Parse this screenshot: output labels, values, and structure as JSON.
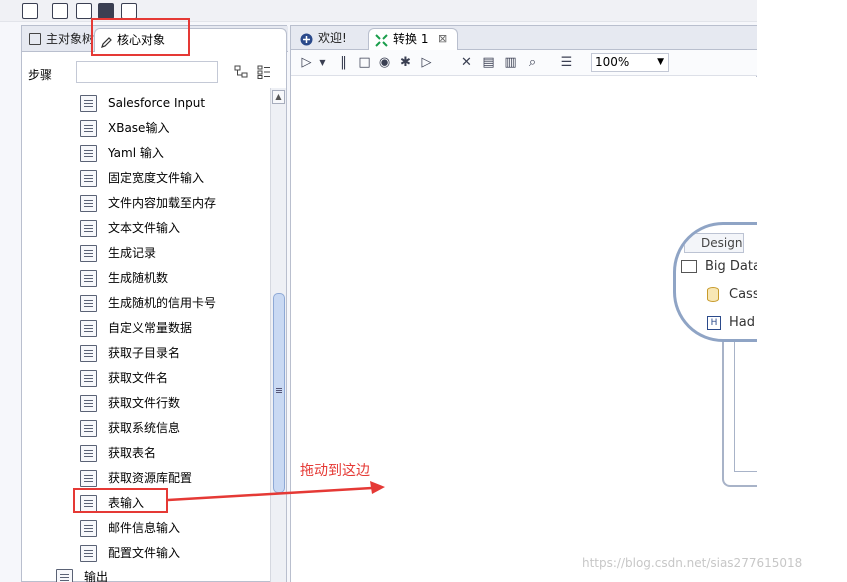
{
  "left_panel": {
    "tabs": [
      {
        "label": "主对象树",
        "icon": "tree-icon"
      },
      {
        "label": "核心对象",
        "icon": "pencil-icon"
      }
    ],
    "search": {
      "label": "步骤",
      "value": "",
      "placeholder": ""
    },
    "items": [
      {
        "label": "Salesforce Input",
        "icon": "salesforce-icon"
      },
      {
        "label": "XBase输入",
        "icon": "xbase-icon"
      },
      {
        "label": "Yaml 输入",
        "icon": "yaml-icon"
      },
      {
        "label": "固定宽度文件输入",
        "icon": "file-icon"
      },
      {
        "label": "文件内容加载至内存",
        "icon": "file-icon"
      },
      {
        "label": "文本文件输入",
        "icon": "file-icon"
      },
      {
        "label": "生成记录",
        "icon": "records-icon"
      },
      {
        "label": "生成随机数",
        "icon": "random-icon"
      },
      {
        "label": "生成随机的信用卡号",
        "icon": "credit-card-icon"
      },
      {
        "label": "自定义常量数据",
        "icon": "table-icon"
      },
      {
        "label": "获取子目录名",
        "icon": "folder-icon"
      },
      {
        "label": "获取文件名",
        "icon": "file-icon"
      },
      {
        "label": "获取文件行数",
        "icon": "file-icon"
      },
      {
        "label": "获取系统信息",
        "icon": "system-info-icon"
      },
      {
        "label": "获取表名",
        "icon": "table-icon"
      },
      {
        "label": "获取资源库配置",
        "icon": "repository-icon"
      },
      {
        "label": "表输入",
        "icon": "table-input-icon"
      },
      {
        "label": "邮件信息输入",
        "icon": "mail-icon"
      },
      {
        "label": "配置文件输入",
        "icon": "config-file-icon"
      },
      {
        "label": "输出",
        "icon": "folder-icon"
      }
    ]
  },
  "right_panel": {
    "tabs": [
      {
        "label": "欢迎!",
        "icon": "welcome-icon"
      },
      {
        "label": "转换 1",
        "icon": "transform-icon",
        "close": "⊠"
      }
    ],
    "zoom": "100%",
    "palette": {
      "design_tab": "Design",
      "rows": [
        "Big Data",
        "Cass",
        "Had"
      ]
    }
  },
  "annotation": {
    "text": "拖动到这边"
  },
  "watermark": "https://blog.csdn.net/sias277615018",
  "colors": {
    "annotation": "#e53935",
    "tab_border": "#b9bfce"
  }
}
